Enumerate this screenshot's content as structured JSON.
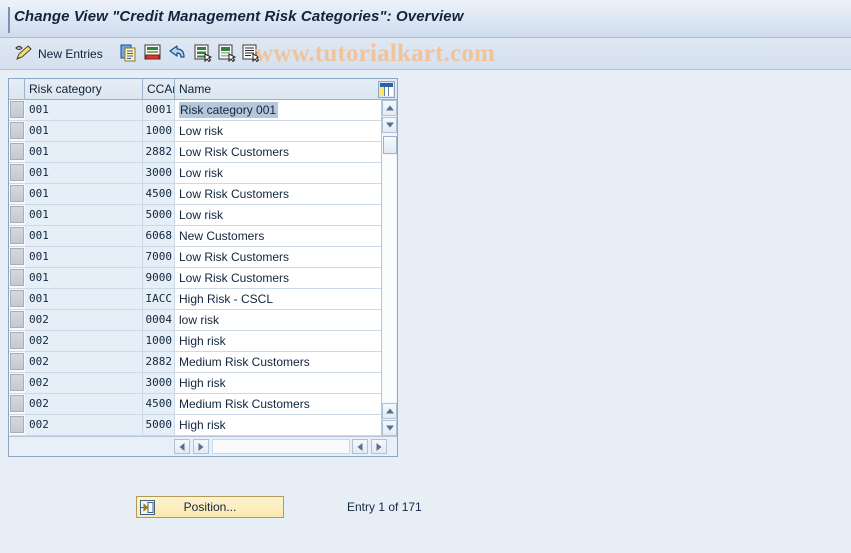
{
  "window": {
    "title": "Change View \"Credit Management Risk Categories\": Overview"
  },
  "toolbar": {
    "new_entries_label": "New Entries",
    "icons": [
      {
        "name": "pencil-icon",
        "title": "New Entries"
      },
      {
        "name": "copy-icon",
        "title": "Copy As..."
      },
      {
        "name": "delete-icon",
        "title": "Delete"
      },
      {
        "name": "undo-icon",
        "title": "Undo Change"
      },
      {
        "name": "select-all-icon",
        "title": "Select All"
      },
      {
        "name": "deselect-all-icon",
        "title": "Deselect All"
      },
      {
        "name": "details-icon",
        "title": "Details"
      }
    ]
  },
  "watermark": {
    "text": "www.tutorialkart.com",
    "color": "#f0c39a"
  },
  "table": {
    "columns": [
      {
        "key": "risk_category",
        "label": "Risk category"
      },
      {
        "key": "ccar",
        "label": "CCAr"
      },
      {
        "key": "name",
        "label": "Name"
      }
    ],
    "selected_row_index": 0,
    "rows": [
      {
        "risk_category": "001",
        "ccar": "0001",
        "name": "Risk category 001"
      },
      {
        "risk_category": "001",
        "ccar": "1000",
        "name": "Low risk"
      },
      {
        "risk_category": "001",
        "ccar": "2882",
        "name": "Low Risk Customers"
      },
      {
        "risk_category": "001",
        "ccar": "3000",
        "name": "Low risk"
      },
      {
        "risk_category": "001",
        "ccar": "4500",
        "name": "Low Risk Customers"
      },
      {
        "risk_category": "001",
        "ccar": "5000",
        "name": "Low risk"
      },
      {
        "risk_category": "001",
        "ccar": "6068",
        "name": "New Customers"
      },
      {
        "risk_category": "001",
        "ccar": "7000",
        "name": "Low Risk Customers"
      },
      {
        "risk_category": "001",
        "ccar": "9000",
        "name": "Low Risk Customers"
      },
      {
        "risk_category": "001",
        "ccar": "IACC",
        "name": "High Risk - CSCL"
      },
      {
        "risk_category": "002",
        "ccar": "0004",
        "name": "low risk"
      },
      {
        "risk_category": "002",
        "ccar": "1000",
        "name": "High risk"
      },
      {
        "risk_category": "002",
        "ccar": "2882",
        "name": "Medium Risk Customers"
      },
      {
        "risk_category": "002",
        "ccar": "3000",
        "name": "High risk"
      },
      {
        "risk_category": "002",
        "ccar": "4500",
        "name": "Medium Risk Customers"
      },
      {
        "risk_category": "002",
        "ccar": "5000",
        "name": "High risk"
      }
    ]
  },
  "footer": {
    "position_button_label": "Position...",
    "entry_status": "Entry 1 of 171"
  }
}
